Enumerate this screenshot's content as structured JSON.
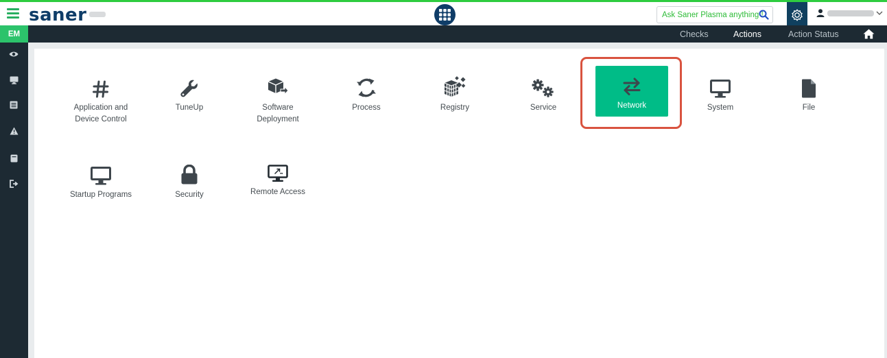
{
  "topbar": {
    "brand": "saner",
    "ask": {
      "green_text": "Ask Saner Plasma anything !",
      "icon": "search-icon"
    },
    "apps_icon": "grid-icon",
    "settings_icon": "gear-icon",
    "user_icon": "user-icon",
    "chevron_icon": "chevron-down-icon"
  },
  "navbar": {
    "items": [
      {
        "label": "Checks"
      },
      {
        "label": "Actions",
        "active": true
      },
      {
        "label": "Action Status"
      }
    ],
    "home_icon": "home-icon"
  },
  "sidebar": {
    "badge": "EM",
    "icons": [
      "eye-icon",
      "monitor-icon",
      "list-icon",
      "warning-icon",
      "book-icon",
      "signout-icon"
    ]
  },
  "actions": {
    "row1": [
      {
        "label": "Application and Device Control",
        "icon": "hash-icon"
      },
      {
        "label": "TuneUp",
        "icon": "wrench-icon"
      },
      {
        "label": "Software Deployment",
        "icon": "package-icon"
      },
      {
        "label": "Process",
        "icon": "refresh-icon"
      },
      {
        "label": "Registry",
        "icon": "registry-icon"
      },
      {
        "label": "Service",
        "icon": "gears-icon"
      },
      {
        "label": "Network",
        "icon": "exchange-icon",
        "selected": true
      },
      {
        "label": "System",
        "icon": "monitor-icon"
      },
      {
        "label": "File",
        "icon": "file-icon"
      }
    ],
    "row2": [
      {
        "label": "Startup Programs",
        "icon": "monitor-icon"
      },
      {
        "label": "Security",
        "icon": "lock-icon"
      },
      {
        "label": "Remote Access",
        "icon": "remote-screen-icon"
      }
    ]
  },
  "colors": {
    "accent_green": "#2ecc40",
    "brand_navy": "#0f3d68",
    "selected_tile": "#00bc87",
    "highlight_red": "#d9533f",
    "dark_bar": "#1d2a33"
  }
}
